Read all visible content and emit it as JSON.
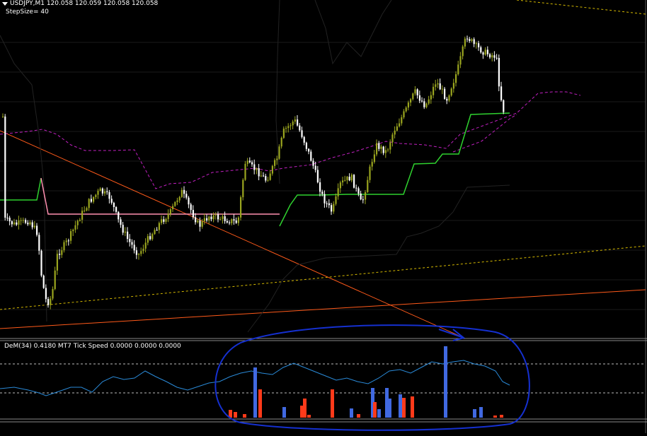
{
  "window": {
    "symbol_header": "USDJPY,M1  120.058 120.059 120.058 120.058",
    "step_size": "StepSize= 40"
  },
  "indicator": {
    "title": "DeM(34) 0.4180  MT7 Tick Speed 0.0000 0.0000 0.0000"
  },
  "colors": {
    "background": "#000000",
    "bull_candle": "#9aa51f",
    "bear_candle": "#ffffff",
    "green_line": "#2fd12f",
    "magenta_dash": "#c020c0",
    "pink_line": "#ff8fb0",
    "orange_line": "#ff5a1a",
    "yellow_dash": "#d4b800",
    "dem_line": "#2a8ad8",
    "tick_blue": "#4169e1",
    "tick_red": "#ff3a1a",
    "annotation": "#1530d0"
  }
}
